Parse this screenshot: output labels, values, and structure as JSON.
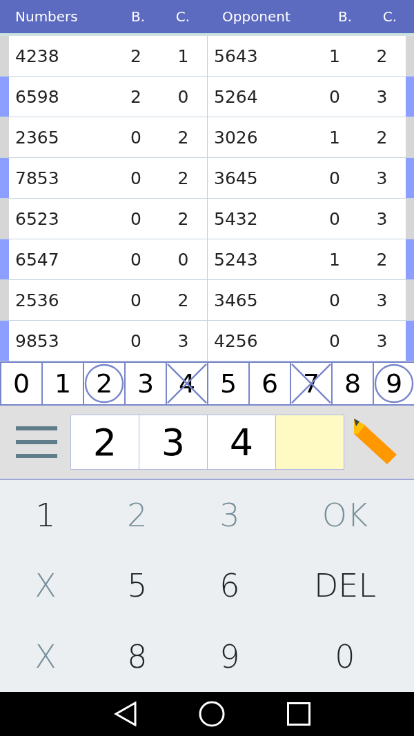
{
  "header": [
    "Numbers",
    "B.",
    "C.",
    "Opponent",
    "B.",
    "C."
  ],
  "rows": [
    {
      "highlighted": false,
      "cells": [
        "4238",
        "2",
        "1",
        "5643",
        "1",
        "2"
      ]
    },
    {
      "highlighted": true,
      "cells": [
        "6598",
        "2",
        "0",
        "5264",
        "0",
        "3"
      ]
    },
    {
      "highlighted": false,
      "cells": [
        "2365",
        "0",
        "2",
        "3026",
        "1",
        "2"
      ]
    },
    {
      "highlighted": true,
      "cells": [
        "7853",
        "0",
        "2",
        "3645",
        "0",
        "3"
      ]
    },
    {
      "highlighted": false,
      "cells": [
        "6523",
        "0",
        "2",
        "5432",
        "0",
        "3"
      ]
    },
    {
      "highlighted": true,
      "cells": [
        "6547",
        "0",
        "0",
        "5243",
        "1",
        "2"
      ]
    },
    {
      "highlighted": false,
      "cells": [
        "2536",
        "0",
        "2",
        "3465",
        "0",
        "3"
      ]
    },
    {
      "highlighted": true,
      "cells": [
        "9853",
        "0",
        "3",
        "4256",
        "0",
        "3"
      ]
    }
  ],
  "digits": [
    {
      "label": "0",
      "circled": false,
      "crossed": false
    },
    {
      "label": "1",
      "circled": false,
      "crossed": false
    },
    {
      "label": "2",
      "circled": true,
      "crossed": false
    },
    {
      "label": "3",
      "circled": false,
      "crossed": false
    },
    {
      "label": "4",
      "circled": false,
      "crossed": true
    },
    {
      "label": "5",
      "circled": false,
      "crossed": false
    },
    {
      "label": "6",
      "circled": false,
      "crossed": false
    },
    {
      "label": "7",
      "circled": false,
      "crossed": true
    },
    {
      "label": "8",
      "circled": false,
      "crossed": false
    },
    {
      "label": "9",
      "circled": true,
      "crossed": false
    }
  ],
  "guess": [
    {
      "value": "2",
      "selected": false
    },
    {
      "value": "3",
      "selected": false
    },
    {
      "value": "4",
      "selected": false
    },
    {
      "selected": true
    }
  ],
  "keypad": [
    {
      "label": "1",
      "disabled": false
    },
    {
      "label": "2",
      "disabled": true
    },
    {
      "label": "3",
      "disabled": true
    },
    {
      "label": "OK",
      "disabled": true
    },
    {
      "label": "X",
      "disabled": true
    },
    {
      "label": "5",
      "disabled": false
    },
    {
      "label": "6",
      "disabled": false
    },
    {
      "label": "DEL",
      "disabled": false
    },
    {
      "label": "X",
      "disabled": true
    },
    {
      "label": "8",
      "disabled": false
    },
    {
      "label": "9",
      "disabled": false
    },
    {
      "label": "0",
      "disabled": false
    }
  ]
}
